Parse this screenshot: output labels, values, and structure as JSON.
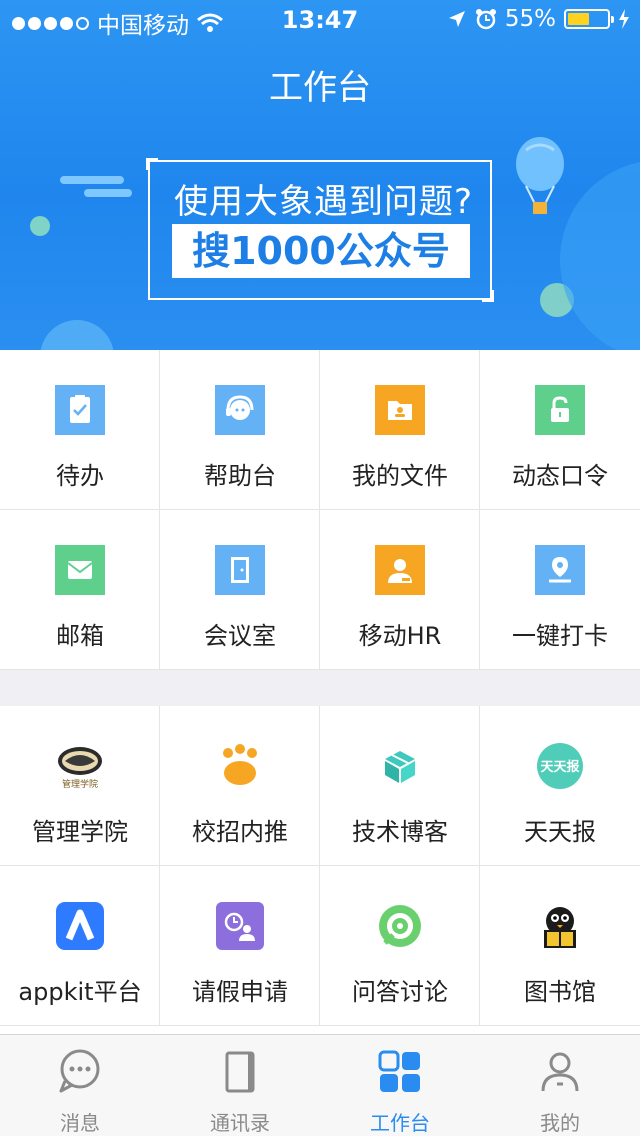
{
  "status_bar": {
    "carrier": "中国移动",
    "time": "13:47",
    "battery_percent": "55%",
    "battery_level": 0.55,
    "signal_bars_filled": 4,
    "signal_bars_total": 5
  },
  "header": {
    "title": "工作台"
  },
  "banner": {
    "line1": "使用大象遇到问题?",
    "line2": "搜1000公众号"
  },
  "grid_top": [
    {
      "label": "待办",
      "icon": "clipboard-check-icon",
      "color": "#64b2f5"
    },
    {
      "label": "帮助台",
      "icon": "headset-support-icon",
      "color": "#64b2f5"
    },
    {
      "label": "我的文件",
      "icon": "folder-user-icon",
      "color": "#f6a623"
    },
    {
      "label": "动态口令",
      "icon": "unlock-icon",
      "color": "#5fcf8c"
    },
    {
      "label": "邮箱",
      "icon": "mail-icon",
      "color": "#5fcf8c"
    },
    {
      "label": "会议室",
      "icon": "door-icon",
      "color": "#64b2f5"
    },
    {
      "label": "移动HR",
      "icon": "person-card-icon",
      "color": "#f6a623"
    },
    {
      "label": "一键打卡",
      "icon": "location-pin-icon",
      "color": "#64b2f5"
    }
  ],
  "grid_bottom": [
    {
      "label": "管理学院",
      "icon": "academy-logo-icon"
    },
    {
      "label": "校招内推",
      "icon": "paw-icon"
    },
    {
      "label": "技术博客",
      "icon": "cube-logo-icon"
    },
    {
      "label": "天天报",
      "icon": "tiantianbao-logo-icon",
      "logo_text": "天天报"
    },
    {
      "label": "appkit平台",
      "icon": "appkit-logo-icon"
    },
    {
      "label": "请假申请",
      "icon": "clock-user-icon"
    },
    {
      "label": "问答讨论",
      "icon": "qa-target-icon"
    },
    {
      "label": "图书馆",
      "icon": "penguin-book-icon"
    }
  ],
  "tabbar": {
    "tabs": [
      {
        "label": "消息",
        "icon": "chat-bubble-icon",
        "active": false
      },
      {
        "label": "通讯录",
        "icon": "contacts-book-icon",
        "active": false
      },
      {
        "label": "工作台",
        "icon": "grid-apps-icon",
        "active": true
      },
      {
        "label": "我的",
        "icon": "person-icon",
        "active": false
      }
    ],
    "active_color": "#2a8cf0",
    "inactive_color": "#8a8a8a"
  }
}
